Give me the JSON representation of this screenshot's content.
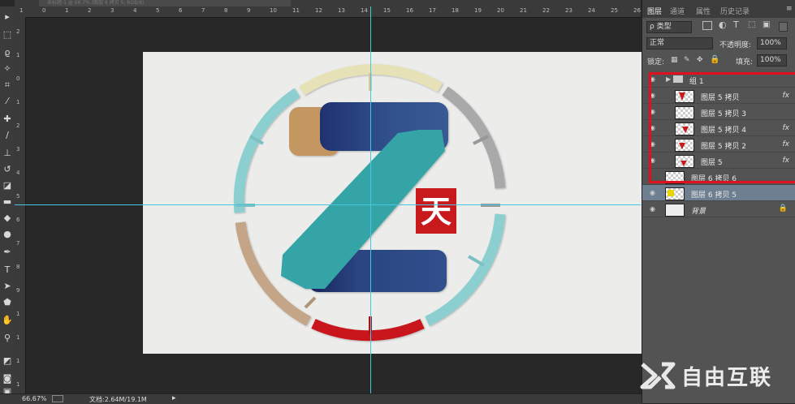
{
  "document_tab": {
    "title": "未标题-1 @ 66.7% (图层 6 拷贝 5, RGB/8)"
  },
  "toolbar": {
    "tools": [
      {
        "name": "move-tool-icon",
        "glyph": "▸"
      },
      {
        "name": "marquee-tool-icon",
        "glyph": "⬚"
      },
      {
        "name": "lasso-tool-icon",
        "glyph": "ϱ"
      },
      {
        "name": "magic-wand-icon",
        "glyph": "✧"
      },
      {
        "name": "crop-tool-icon",
        "glyph": "⌗"
      },
      {
        "name": "eyedropper-icon",
        "glyph": "⁄"
      },
      {
        "name": "healing-brush-icon",
        "glyph": "✚"
      },
      {
        "name": "brush-tool-icon",
        "glyph": "∕"
      },
      {
        "name": "clone-stamp-icon",
        "glyph": "⊥"
      },
      {
        "name": "history-brush-icon",
        "glyph": "↺"
      },
      {
        "name": "eraser-tool-icon",
        "glyph": "◪"
      },
      {
        "name": "gradient-tool-icon",
        "glyph": "▬"
      },
      {
        "name": "blur-tool-icon",
        "glyph": "◆"
      },
      {
        "name": "dodge-tool-icon",
        "glyph": "●"
      },
      {
        "name": "pen-tool-icon",
        "glyph": "✒"
      },
      {
        "name": "type-tool-icon",
        "glyph": "T"
      },
      {
        "name": "path-selection-icon",
        "glyph": "➤"
      },
      {
        "name": "shape-tool-icon",
        "glyph": "⬟"
      },
      {
        "name": "hand-tool-icon",
        "glyph": "✋"
      },
      {
        "name": "zoom-tool-icon",
        "glyph": "⚲"
      },
      {
        "name": "color-swatch-icon",
        "glyph": "◩"
      },
      {
        "name": "quick-mask-icon",
        "glyph": "◙"
      },
      {
        "name": "screen-mode-icon",
        "glyph": "▣"
      }
    ]
  },
  "rulers": {
    "top": [
      "1",
      "0",
      "1",
      "2",
      "3",
      "4",
      "5",
      "6",
      "7",
      "8",
      "9",
      "10",
      "11",
      "12",
      "13",
      "14",
      "15",
      "16",
      "17",
      "18",
      "19",
      "20",
      "21",
      "22",
      "23",
      "24",
      "25",
      "26"
    ],
    "left": [
      "2",
      "1",
      "0",
      "1",
      "2",
      "3",
      "4",
      "5",
      "6",
      "7",
      "8",
      "9",
      "1",
      "1",
      "1",
      "1"
    ]
  },
  "logo": {
    "badge_char": "天",
    "colors": {
      "teal": "#34a4a6",
      "blue": "#2f4f8a",
      "tan": "#c49661",
      "red": "#c8191d"
    }
  },
  "status": {
    "zoom": "66.67%",
    "doc_info": "文档:2.64M/19.1M"
  },
  "panel": {
    "tabs": [
      "图层",
      "通道",
      "属性",
      "历史记录"
    ],
    "filter_kind": "ρ 类型",
    "blend_mode": "正常",
    "opacity_label": "不透明度:",
    "opacity_value": "100%",
    "lock_label": "锁定:",
    "fill_label": "填充:",
    "fill_value": "100%",
    "layers": [
      {
        "name": "组 1",
        "type": "group",
        "fx": ""
      },
      {
        "name": "图层 5 拷贝",
        "type": "layer",
        "fx": "fx"
      },
      {
        "name": "图层 5 拷贝 3",
        "type": "layer",
        "fx": ""
      },
      {
        "name": "图层 5 拷贝 4",
        "type": "layer",
        "fx": "fx"
      },
      {
        "name": "图层 5 拷贝 2",
        "type": "layer",
        "fx": "fx"
      },
      {
        "name": "图层 5",
        "type": "layer",
        "fx": "fx"
      },
      {
        "name": "图层 6 拷贝 6",
        "type": "layer",
        "fx": ""
      },
      {
        "name": "图层 6 拷贝 5",
        "type": "layer-selected",
        "fx": ""
      },
      {
        "name": "背景",
        "type": "background",
        "fx": ""
      }
    ]
  },
  "watermark": {
    "text": "自由互联"
  }
}
